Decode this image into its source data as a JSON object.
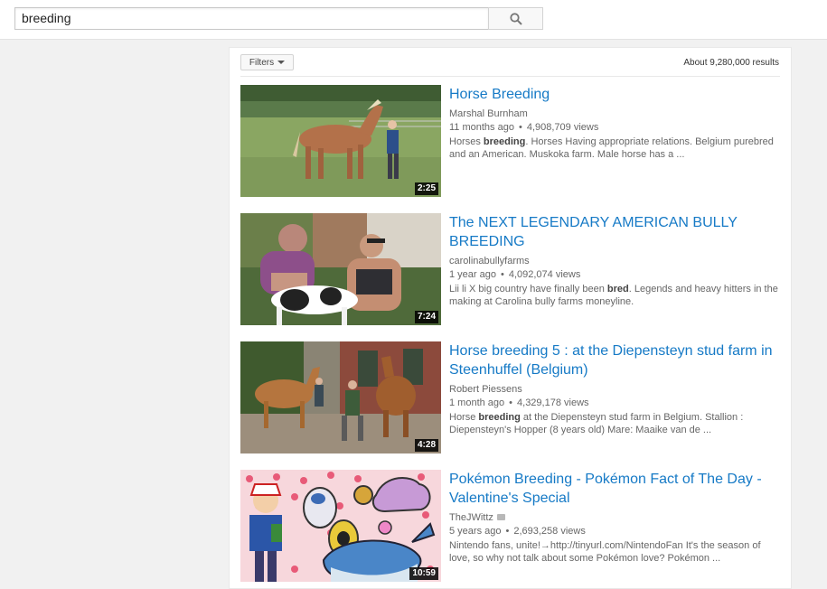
{
  "search": {
    "query": "breeding"
  },
  "toolbar": {
    "filters_label": "Filters",
    "results_count": "About 9,280,000 results"
  },
  "results": [
    {
      "title": "Horse Breeding",
      "channel": "Marshal Burnham",
      "age": "11 months ago",
      "views": "4,908,709 views",
      "desc_pre": "Horses ",
      "desc_bold": "breeding",
      "desc_post": ". Horses Having appropriate relations. Belgium purebred and an American. Muskoka farm. Male horse has a ...",
      "duration": "2:25"
    },
    {
      "title": "The NEXT LEGENDARY AMERICAN BULLY BREEDING",
      "channel": "carolinabullyfarms",
      "age": "1 year ago",
      "views": "4,092,074 views",
      "desc_pre": "Lii li X big country have finally been ",
      "desc_bold": "bred",
      "desc_post": ". Legends and heavy hitters in the making at Carolina bully farms moneyline.",
      "duration": "7:24"
    },
    {
      "title": "Horse breeding 5 : at the Diepensteyn stud farm in Steenhuffel (Belgium)",
      "channel": "Robert Piessens",
      "age": "1 month ago",
      "views": "4,329,178 views",
      "desc_pre": "Horse ",
      "desc_bold": "breeding",
      "desc_post": " at the Diepensteyn stud farm in Belgium. Stallion : Diepensteyn's Hopper (8 years old) Mare: Maaike van de ...",
      "duration": "4:28"
    },
    {
      "title": "Pokémon Breeding - Pokémon Fact of The Day - Valentine's Special",
      "channel": "TheJWittz",
      "age": "5 years ago",
      "views": "2,693,258 views",
      "desc_pre": "Nintendo fans, unite!→http://tinyurl.com/NintendoFan It's the season of love, so why not talk about some Pokémon love? Pokémon ...",
      "desc_bold": "",
      "desc_post": "",
      "duration": "10:59"
    }
  ],
  "colors": {
    "link": "#167ac6",
    "meta": "#666666",
    "background": "#f1f1f1"
  }
}
